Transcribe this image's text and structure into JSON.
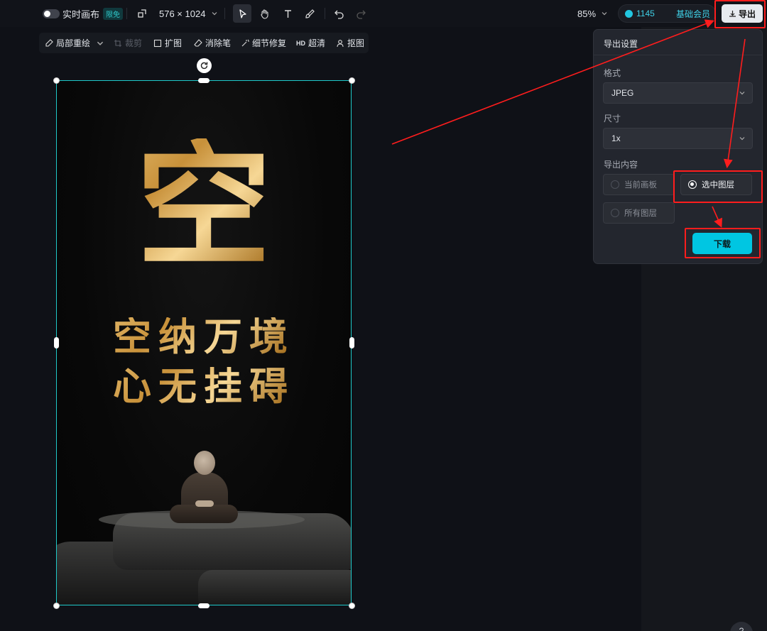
{
  "toolbar": {
    "realtime_canvas_label": "实时画布",
    "free_badge": "限免",
    "canvas_size": "576 × 1024",
    "zoom": "85%",
    "credits": "1145",
    "membership": "基础会员",
    "export_label": "导出"
  },
  "subtoolbar": {
    "items": [
      "局部重绘",
      "裁剪",
      "扩图",
      "消除笔",
      "细节修复",
      "超清",
      "抠图"
    ],
    "hd_badge": "HD"
  },
  "artboard": {
    "big_char": "空",
    "line1": "空纳万境",
    "line2": "心无挂碍"
  },
  "export_panel": {
    "title": "导出设置",
    "format_label": "格式",
    "format_value": "JPEG",
    "size_label": "尺寸",
    "size_value": "1x",
    "content_label": "导出内容",
    "options": [
      "当前画板",
      "选中图层",
      "所有图层"
    ],
    "selected_option": "选中图层",
    "download_label": "下载"
  },
  "colors": {
    "accent": "#00c6e2",
    "selection": "#1fc9c9",
    "annotation": "#ff1d1d"
  }
}
